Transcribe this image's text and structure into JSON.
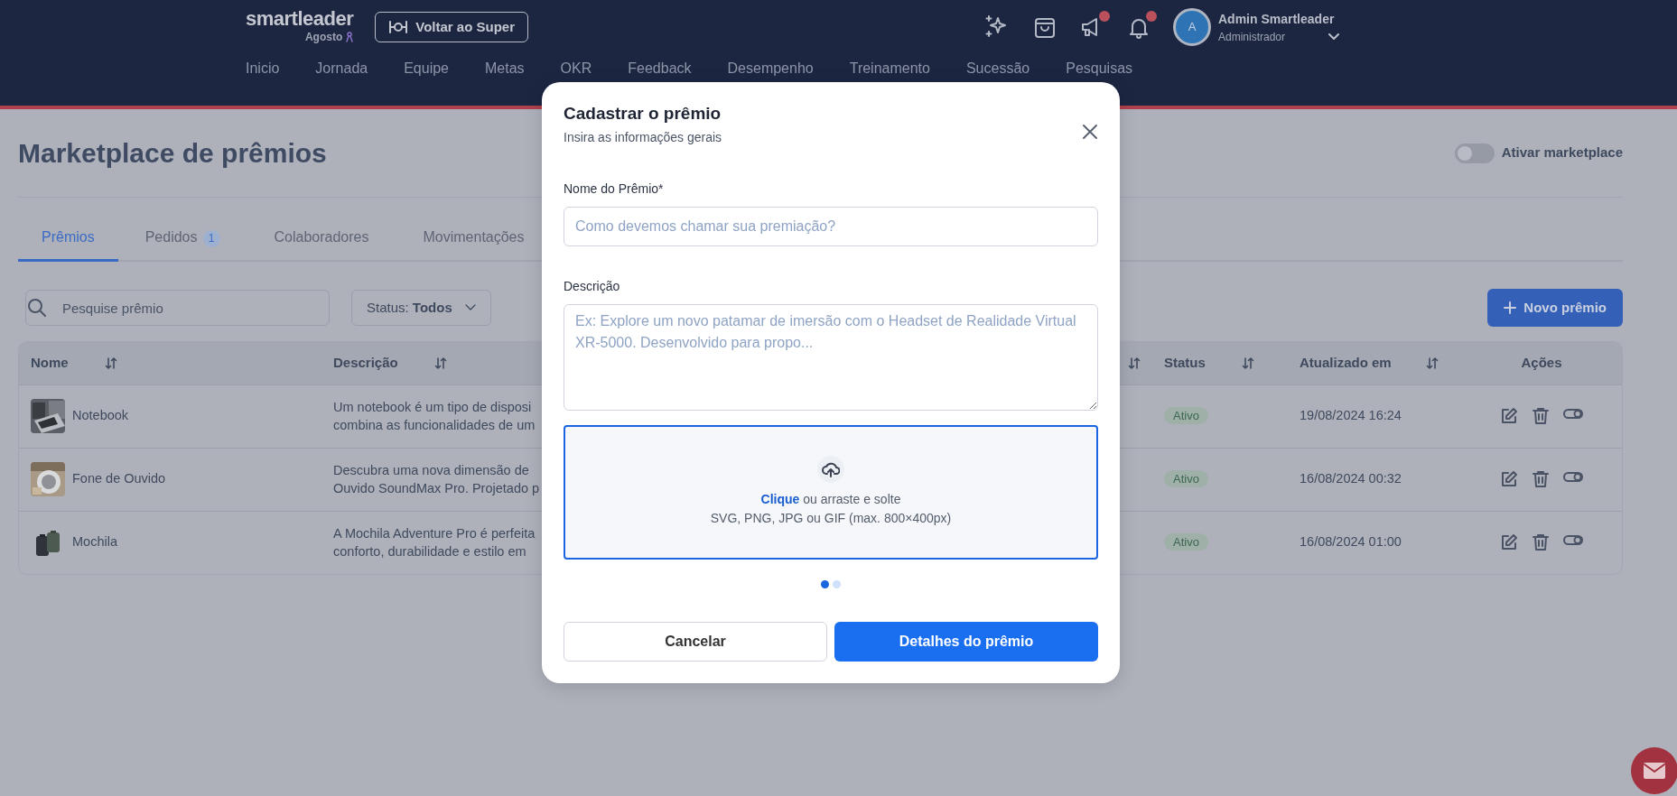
{
  "header": {
    "logo": "smartleader",
    "logo_sub": "Agosto",
    "back_button": "Voltar ao Super",
    "icons": [
      {
        "kind": "sparkles",
        "dot": false
      },
      {
        "kind": "bag",
        "dot": false
      },
      {
        "kind": "megaphone",
        "dot": true
      },
      {
        "kind": "bell",
        "dot": true
      }
    ],
    "user": {
      "initial": "A",
      "name": "Admin Smartleader",
      "role": "Administrador"
    }
  },
  "nav": [
    "Inicio",
    "Jornada",
    "Equipe",
    "Metas",
    "OKR",
    "Feedback",
    "Desempenho",
    "Treinamento",
    "Sucessão",
    "Pesquisas"
  ],
  "page": {
    "title": "Marketplace de prêmios",
    "toggle": {
      "label": "Ativar marketplace",
      "on": false
    },
    "tabs": [
      {
        "label": "Prêmios",
        "selected": true
      },
      {
        "label": "Pedidos",
        "badge": "1",
        "selected": false
      },
      {
        "label": "Colaboradores",
        "selected": false
      },
      {
        "label": "Movimentações",
        "selected": false
      }
    ],
    "search": {
      "placeholder": "Pesquise prêmio"
    },
    "status_filter": {
      "label": "Status:",
      "value": "Todos"
    },
    "new_button": "Novo prêmio",
    "table": {
      "columns": [
        {
          "label": "Nome",
          "sortable": true
        },
        {
          "label": "Descrição",
          "sortable": true
        },
        {
          "sortable": true
        },
        {
          "label": "Status",
          "sortable": true
        },
        {
          "label": "Atualizado em",
          "sortable": true
        },
        {
          "label": "Ações",
          "sortable": false
        }
      ],
      "rows": [
        {
          "name": "Notebook",
          "image": {
            "kind": "picture"
          },
          "description": [
            "Um notebook é um tipo de disposi",
            "combina as funcionalidades de um"
          ],
          "status": "Ativo",
          "updated": "19/08/2024 16:24"
        },
        {
          "name": "Fone de Ouvido",
          "image": {
            "kind": "picture"
          },
          "description": [
            "Descubra uma nova dimensão de",
            "Ouvido SoundMax Pro. Projetado p"
          ],
          "status": "Ativo",
          "updated": "16/08/2024 00:32"
        },
        {
          "name": "Mochila",
          "image": {
            "kind": "picture"
          },
          "description": [
            "A Mochila Adventure Pro é perfeita",
            "conforto, durabilidade e estilo em"
          ],
          "status": "Ativo",
          "updated": "16/08/2024 01:00"
        }
      ]
    }
  },
  "modal": {
    "title": "Cadastrar o prêmio",
    "subtitle": "Insira as informações gerais",
    "name_field": {
      "label": "Nome do Prêmio*",
      "placeholder": "Como devemos chamar sua premiação?"
    },
    "description_field": {
      "label": "Descrição",
      "placeholder": "Ex: Explore um novo patamar de imersão com o Headset de Realidade Virtual XR-5000. Desenvolvido para propo..."
    },
    "upload": {
      "link": "Clique",
      "text": "ou arraste e solte",
      "hint": "SVG, PNG, JPG ou GIF (max. 800×400px)"
    },
    "steps": [
      {
        "selected": true
      },
      {
        "selected": false
      }
    ],
    "cancel_button": "Cancelar",
    "next_button": "Detalhes do prêmio"
  }
}
